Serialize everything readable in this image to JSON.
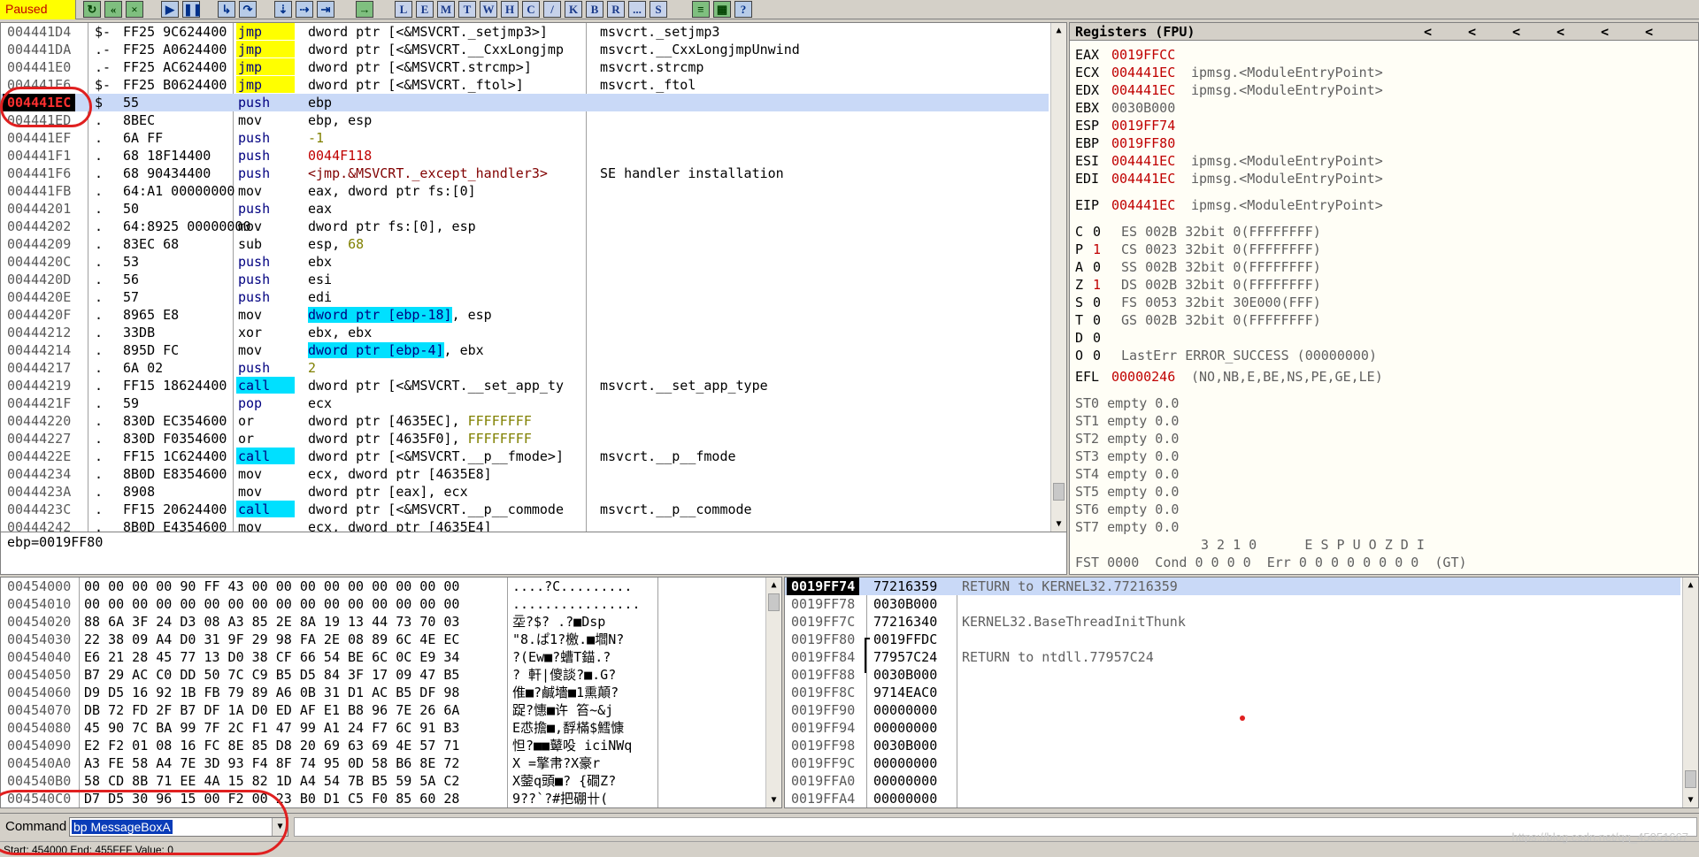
{
  "toolbar": {
    "status": "Paused",
    "letter_buttons": [
      "L",
      "E",
      "M",
      "T",
      "W",
      "H",
      "C",
      "/",
      "K",
      "B",
      "R",
      "...",
      "S"
    ]
  },
  "disasm": {
    "rows": [
      {
        "addr": "004441D4",
        "sym": "$-",
        "hex": "FF25 9C624400",
        "mn": "jmp",
        "mn_style": "yellow",
        "op": "dword ptr [<&MSVCRT._setjmp3>]",
        "cm": "msvcrt._setjmp3"
      },
      {
        "addr": "004441DA",
        "sym": ".-",
        "hex": "FF25 A0624400",
        "mn": "jmp",
        "mn_style": "yellow",
        "op": "dword ptr [<&MSVCRT.__CxxLongjmp",
        "cm": "msvcrt.__CxxLongjmpUnwind"
      },
      {
        "addr": "004441E0",
        "sym": ".-",
        "hex": "FF25 AC624400",
        "mn": "jmp",
        "mn_style": "yellow",
        "op": "dword ptr [<&MSVCRT.strcmp>]",
        "cm": "msvcrt.strcmp"
      },
      {
        "addr": "004441E6",
        "sym": "$-",
        "hex": "FF25 B0624400",
        "mn": "jmp",
        "mn_style": "yellow",
        "op": "dword ptr [<&MSVCRT._ftol>]",
        "cm": "msvcrt._ftol"
      },
      {
        "addr": "004441EC",
        "sym": "$",
        "hex": "55",
        "mn": "push",
        "mn_style": "blue",
        "op": "ebp",
        "cm": "",
        "current": true
      },
      {
        "addr": "004441ED",
        "sym": ".",
        "hex": "8BEC",
        "mn": "mov",
        "mn_style": "plain",
        "op": "ebp, esp",
        "cm": ""
      },
      {
        "addr": "004441EF",
        "sym": ".",
        "hex": "6A FF",
        "mn": "push",
        "mn_style": "blue",
        "op": "-1",
        "op_style": "olive",
        "cm": ""
      },
      {
        "addr": "004441F1",
        "sym": ".",
        "hex": "68 18F14400",
        "mn": "push",
        "mn_style": "blue",
        "op": "0044F118",
        "op_style": "red",
        "cm": ""
      },
      {
        "addr": "004441F6",
        "sym": ".",
        "hex": "68 90434400",
        "mn": "push",
        "mn_style": "blue",
        "op": "<jmp.&MSVCRT._except_handler3>",
        "op_style": "maroon",
        "cm": "SE handler installation"
      },
      {
        "addr": "004441FB",
        "sym": ".",
        "hex": "64:A1 00000000",
        "mn": "mov",
        "mn_style": "plain",
        "op": "eax, dword ptr fs:[0]",
        "cm": ""
      },
      {
        "addr": "00444201",
        "sym": ".",
        "hex": "50",
        "mn": "push",
        "mn_style": "blue",
        "op": "eax",
        "cm": ""
      },
      {
        "addr": "00444202",
        "sym": ".",
        "hex": "64:8925 00000000",
        "mn": "mov",
        "mn_style": "plain",
        "op": "dword ptr fs:[0], esp",
        "cm": ""
      },
      {
        "addr": "00444209",
        "sym": ".",
        "hex": "83EC 68",
        "mn": "sub",
        "mn_style": "plain",
        "op": "esp, 68",
        "cm": ""
      },
      {
        "addr": "0044420C",
        "sym": ".",
        "hex": "53",
        "mn": "push",
        "mn_style": "blue",
        "op": "ebx",
        "cm": ""
      },
      {
        "addr": "0044420D",
        "sym": ".",
        "hex": "56",
        "mn": "push",
        "mn_style": "blue",
        "op": "esi",
        "cm": ""
      },
      {
        "addr": "0044420E",
        "sym": ".",
        "hex": "57",
        "mn": "push",
        "mn_style": "blue",
        "op": "edi",
        "cm": ""
      },
      {
        "addr": "0044420F",
        "sym": ".",
        "hex": "8965 E8",
        "mn": "mov",
        "mn_style": "plain",
        "op": "dword ptr [ebp-18], esp",
        "cm": ""
      },
      {
        "addr": "00444212",
        "sym": ".",
        "hex": "33DB",
        "mn": "xor",
        "mn_style": "plain",
        "op": "ebx, ebx",
        "cm": ""
      },
      {
        "addr": "00444214",
        "sym": ".",
        "hex": "895D FC",
        "mn": "mov",
        "mn_style": "plain",
        "op": "dword ptr [ebp-4], ebx",
        "cm": ""
      },
      {
        "addr": "00444217",
        "sym": ".",
        "hex": "6A 02",
        "mn": "push",
        "mn_style": "blue",
        "op": "2",
        "op_style": "olive",
        "cm": ""
      },
      {
        "addr": "00444219",
        "sym": ".",
        "hex": "FF15 18624400",
        "mn": "call",
        "mn_style": "cyan",
        "op": "dword ptr [<&MSVCRT.__set_app_ty",
        "cm": "msvcrt.__set_app_type"
      },
      {
        "addr": "0044421F",
        "sym": ".",
        "hex": "59",
        "mn": "pop",
        "mn_style": "blue",
        "op": "ecx",
        "cm": ""
      },
      {
        "addr": "00444220",
        "sym": ".",
        "hex": "830D EC354600",
        "mn": "or",
        "mn_style": "plain",
        "op": "dword ptr [4635EC], FFFFFFFF",
        "cm": ""
      },
      {
        "addr": "00444227",
        "sym": ".",
        "hex": "830D F0354600",
        "mn": "or",
        "mn_style": "plain",
        "op": "dword ptr [4635F0], FFFFFFFF",
        "cm": ""
      },
      {
        "addr": "0044422E",
        "sym": ".",
        "hex": "FF15 1C624400",
        "mn": "call",
        "mn_style": "cyan",
        "op": "dword ptr [<&MSVCRT.__p__fmode>]",
        "cm": "msvcrt.__p__fmode"
      },
      {
        "addr": "00444234",
        "sym": ".",
        "hex": "8B0D E8354600",
        "mn": "mov",
        "mn_style": "plain",
        "op": "ecx, dword ptr [4635E8]",
        "cm": ""
      },
      {
        "addr": "0044423A",
        "sym": ".",
        "hex": "8908",
        "mn": "mov",
        "mn_style": "plain",
        "op": "dword ptr [eax], ecx",
        "cm": ""
      },
      {
        "addr": "0044423C",
        "sym": ".",
        "hex": "FF15 20624400",
        "mn": "call",
        "mn_style": "cyan",
        "op": "dword ptr [<&MSVCRT.__p__commode",
        "cm": "msvcrt.__p__commode"
      },
      {
        "addr": "00444242",
        "sym": ".",
        "hex": "8B0D E4354600",
        "mn": "mov",
        "mn_style": "plain",
        "op": "ecx, dword ptr [4635E4]",
        "cm": ""
      }
    ],
    "info_line": "ebp=0019FF80"
  },
  "registers": {
    "title": "Registers (FPU)",
    "nav_arrows": [
      "<",
      "<",
      "<",
      "<",
      "<",
      "<"
    ],
    "general": [
      {
        "name": "EAX",
        "value": "0019FFCC",
        "note": ""
      },
      {
        "name": "ECX",
        "value": "004441EC",
        "note": "ipmsg.<ModuleEntryPoint>"
      },
      {
        "name": "EDX",
        "value": "004441EC",
        "note": "ipmsg.<ModuleEntryPoint>"
      },
      {
        "name": "EBX",
        "value": "0030B000",
        "note": "",
        "plain": true
      },
      {
        "name": "ESP",
        "value": "0019FF74",
        "note": ""
      },
      {
        "name": "EBP",
        "value": "0019FF80",
        "note": ""
      },
      {
        "name": "ESI",
        "value": "004441EC",
        "note": "ipmsg.<ModuleEntryPoint>"
      },
      {
        "name": "EDI",
        "value": "004441EC",
        "note": "ipmsg.<ModuleEntryPoint>"
      }
    ],
    "eip": {
      "name": "EIP",
      "value": "004441EC",
      "note": "ipmsg.<ModuleEntryPoint>"
    },
    "flags": [
      {
        "f": "C",
        "v": "0",
        "seg": "ES 002B 32bit 0(FFFFFFFF)"
      },
      {
        "f": "P",
        "v": "1",
        "seg": "CS 0023 32bit 0(FFFFFFFF)",
        "red": true
      },
      {
        "f": "A",
        "v": "0",
        "seg": "SS 002B 32bit 0(FFFFFFFF)"
      },
      {
        "f": "Z",
        "v": "1",
        "seg": "DS 002B 32bit 0(FFFFFFFF)",
        "red": true
      },
      {
        "f": "S",
        "v": "0",
        "seg": "FS 0053 32bit 30E000(FFF)"
      },
      {
        "f": "T",
        "v": "0",
        "seg": "GS 002B 32bit 0(FFFFFFFF)"
      },
      {
        "f": "D",
        "v": "0",
        "seg": ""
      },
      {
        "f": "O",
        "v": "0",
        "seg": "LastErr ERROR_SUCCESS (00000000)"
      }
    ],
    "efl": {
      "name": "EFL",
      "value": "00000246",
      "note": "(NO,NB,E,BE,NS,PE,GE,LE)"
    },
    "fpu": [
      "ST0 empty 0.0",
      "ST1 empty 0.0",
      "ST2 empty 0.0",
      "ST3 empty 0.0",
      "ST4 empty 0.0",
      "ST5 empty 0.0",
      "ST6 empty 0.0",
      "ST7 empty 0.0"
    ],
    "fpu_hdr": "3 2 1 0      E S P U O Z D I",
    "fst": "FST 0000  Cond 0 0 0 0  Err 0 0 0 0 0 0 0 0  (GT)"
  },
  "dump": {
    "rows": [
      {
        "addr": "00454000",
        "hex": "00 00 00 00 90 FF 43 00 00 00 00 00 00 00 00 00",
        "asc": "....?C........."
      },
      {
        "addr": "00454010",
        "hex": "00 00 00 00 00 00 00 00 00 00 00 00 00 00 00 00",
        "asc": "................"
      },
      {
        "addr": "00454020",
        "hex": "88 6A 3F 24 D3 08 A3 85 2E 8A 19 13 44 73 70 03",
        "asc": "坖?$?  .?■Dsp"
      },
      {
        "addr": "00454030",
        "hex": "22 38 09 A4 D0 31 9F 29 98 FA 2E 08 89 6C 4E EC",
        "asc": "\"8.ぱ1?檄.■壛N?"
      },
      {
        "addr": "00454040",
        "hex": "E6 21 28 45 77 13 D0 38 CF 66 54 BE 6C 0C E9 34",
        "asc": "?(Ew■?螬T錨.?"
      },
      {
        "addr": "00454050",
        "hex": "B7 29 AC C0 DD 50 7C C9 B5 D5 84 3F 17 09 47 B5",
        "asc": "?  軒|傻談?■.G?"
      },
      {
        "addr": "00454060",
        "hex": "D9 D5 16 92 1B FB 79 89 A6 0B 31 D1 AC B5 DF 98",
        "asc": "倠■?鹹墻■1熏顛?"
      },
      {
        "addr": "00454070",
        "hex": "DB 72 FD 2F B7 DF 1A D0 ED AF E1 B8 96 7E 26 6A",
        "asc": "踀?憓■许  笞~&j"
      },
      {
        "addr": "00454080",
        "hex": "45 90 7C BA 99 7F 2C F1 47 99 A1 24 F7 6C 91 B3",
        "asc": "E怷擔■,馟樠$鱈慷"
      },
      {
        "addr": "00454090",
        "hex": "E2 F2 01 08 16 FC 8E 85 D8 20 69 63 69 4E 57 71",
        "asc": "怛?■■鼙吺 iciNWq"
      },
      {
        "addr": "004540A0",
        "hex": "A3 FE 58 A4 7E 3D 93 F4 8F 74 95 0D 58 B6 8E 72",
        "asc": "  X  =擎帇?X豪r"
      },
      {
        "addr": "004540B0",
        "hex": "58 CD 8B 71 EE 4A 15 82 1D A4 54 7B B5 59 5A C2",
        "asc": "X蓥q頭■?  {礀Z?"
      },
      {
        "addr": "004540C0",
        "hex": "D7 D5 30 96 15 00 F2 00 23 B0 D1 C5 F0 85 60 28",
        "asc": "9??`?#把硼卄("
      }
    ]
  },
  "stack": {
    "rows": [
      {
        "addr": "0019FF74",
        "val": "77216359",
        "cm": "RETURN to KERNEL32.77216359",
        "sel": true
      },
      {
        "addr": "0019FF78",
        "val": "0030B000",
        "cm": ""
      },
      {
        "addr": "0019FF7C",
        "val": "77216340",
        "cm": "KERNEL32.BaseThreadInitThunk"
      },
      {
        "addr": "0019FF80",
        "val": "0019FFDC",
        "cm": "",
        "frame": true
      },
      {
        "addr": "0019FF84",
        "val": "77957C24",
        "cm": "RETURN to ntdll.77957C24"
      },
      {
        "addr": "0019FF88",
        "val": "0030B000",
        "cm": ""
      },
      {
        "addr": "0019FF8C",
        "val": "9714EAC0",
        "cm": ""
      },
      {
        "addr": "0019FF90",
        "val": "00000000",
        "cm": ""
      },
      {
        "addr": "0019FF94",
        "val": "00000000",
        "cm": ""
      },
      {
        "addr": "0019FF98",
        "val": "0030B000",
        "cm": ""
      },
      {
        "addr": "0019FF9C",
        "val": "00000000",
        "cm": ""
      },
      {
        "addr": "0019FFA0",
        "val": "00000000",
        "cm": ""
      },
      {
        "addr": "0019FFA4",
        "val": "00000000",
        "cm": ""
      }
    ]
  },
  "command": {
    "label": "Command",
    "value": "bp MessageBoxA"
  },
  "statusbar": {
    "text": "Start: 454000 End: 455FFF Value: 0",
    "watermark": "https://blog.csdn.net/qq_45051667"
  },
  "colors": {
    "current_addr_bg": "#000000",
    "current_addr_fg": "#ff3030",
    "selection_row": "#c9d9f7",
    "annotation": "#e02020"
  }
}
